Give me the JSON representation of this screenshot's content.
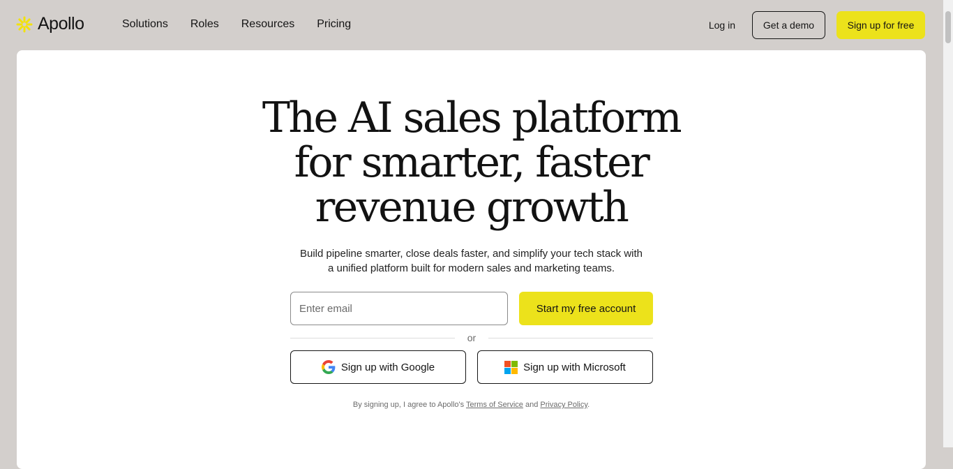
{
  "header": {
    "logo_text": "Apollo",
    "nav": [
      "Solutions",
      "Roles",
      "Resources",
      "Pricing"
    ],
    "login_label": "Log in",
    "demo_label": "Get a demo",
    "signup_label": "Sign up for free",
    "accent_color": "#ece21b"
  },
  "hero": {
    "headline_lines": [
      "The AI sales platform",
      "for smarter, faster",
      "revenue growth"
    ],
    "subtitle_lines": [
      "Build pipeline smarter, close deals faster, and simplify your tech stack with",
      "a unified platform built for modern sales and marketing teams."
    ],
    "email_placeholder": "Enter email",
    "email_value": "",
    "cta_label": "Start my free account",
    "divider_text": "or",
    "google_label": "Sign up with Google",
    "microsoft_label": "Sign up with Microsoft",
    "legal": {
      "prefix": "By signing up, I agree to Apollo's",
      "terms": "Terms of Service",
      "and": "and",
      "privacy": "Privacy Policy",
      "suffix": "."
    }
  },
  "icons": {
    "logo": "sunburst-icon",
    "google": "google-g-icon",
    "microsoft": "microsoft-squares-icon"
  }
}
